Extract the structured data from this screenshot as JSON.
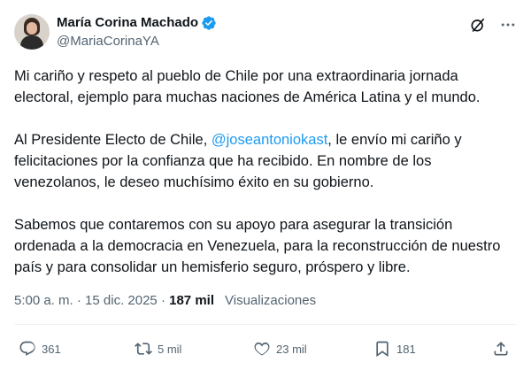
{
  "author": {
    "display_name": "María Corina Machado",
    "handle": "@MariaCorinaYA",
    "avatar_icon": "avatar",
    "verified_icon": "verified-badge-icon",
    "verified_color": "#1d9bf0"
  },
  "header_actions": {
    "grok_icon": "grok-icon",
    "more_icon": "more-options-icon"
  },
  "body": {
    "p1": "Mi cariño y respeto al pueblo de Chile por una extraordinaria jornada electoral, ejemplo para muchas naciones de América Latina y el mundo.",
    "p2_before": "Al Presidente Electo de Chile, ",
    "p2_mention": "@joseantoniokast",
    "p2_after": ", le envío mi cariño y felicitaciones por la confianza que ha recibido. En nombre de los venezolanos, le deseo muchísimo éxito en su gobierno.",
    "p3": "Sabemos que contaremos con su apoyo para asegurar la transición ordenada a la democracia en Venezuela, para la reconstrucción de nuestro país y para consolidar un hemisferio seguro, próspero y libre.",
    "mention_color": "#1d9bf0"
  },
  "meta": {
    "time": "5:00 a. m.",
    "separator": " · ",
    "date": "15 dic. 2025",
    "views_count": "187 mil",
    "views_label": "Visualizaciones"
  },
  "actions": {
    "reply_count": "361",
    "retweet_count": "5 mil",
    "like_count": "23 mil",
    "bookmark_count": "181",
    "icons": [
      "reply-icon",
      "retweet-icon",
      "like-icon",
      "bookmark-icon",
      "share-icon"
    ]
  }
}
